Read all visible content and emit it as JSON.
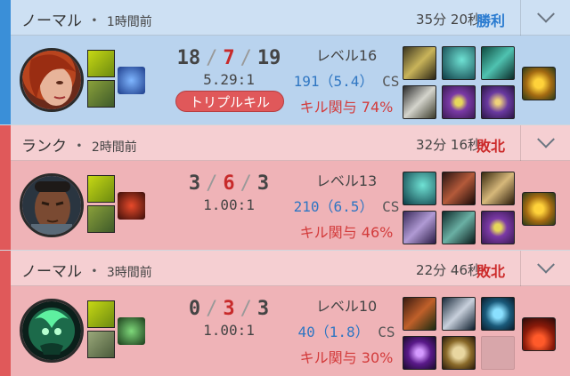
{
  "matches": [
    {
      "queue": "ノーマル",
      "ago": "1時間前",
      "duration": "35分 20秒",
      "result": "勝利",
      "result_type": "win",
      "champion": "champion-portrait",
      "kills": "18",
      "deaths": "7",
      "assists": "19",
      "kda_ratio": "5.29:1",
      "badge": "トリプルキル",
      "level": "レベル16",
      "cs_value": "191（5.4）",
      "cs_label": "CS",
      "kp_label": "キル関与",
      "kp_value": "74%"
    },
    {
      "queue": "ランク",
      "ago": "2時間前",
      "duration": "32分 16秒",
      "result": "敗北",
      "result_type": "loss",
      "champion": "champion-portrait",
      "kills": "3",
      "deaths": "6",
      "assists": "3",
      "kda_ratio": "1.00:1",
      "badge": "",
      "level": "レベル13",
      "cs_value": "210（6.5）",
      "cs_label": "CS",
      "kp_label": "キル関与",
      "kp_value": "46%"
    },
    {
      "queue": "ノーマル",
      "ago": "3時間前",
      "duration": "22分 46秒",
      "result": "敗北",
      "result_type": "loss",
      "champion": "champion-portrait",
      "kills": "0",
      "deaths": "3",
      "assists": "3",
      "kda_ratio": "1.00:1",
      "badge": "",
      "level": "レベル10",
      "cs_value": "40（1.8）",
      "cs_label": "CS",
      "kp_label": "キル関与",
      "kp_value": "30%"
    }
  ],
  "separator": "・",
  "kda_separator": "/",
  "colors": {
    "win_accent": "#3a8fd8",
    "loss_accent": "#e0595a",
    "win_text": "#2a7bd0",
    "loss_text": "#cc2b2b"
  }
}
